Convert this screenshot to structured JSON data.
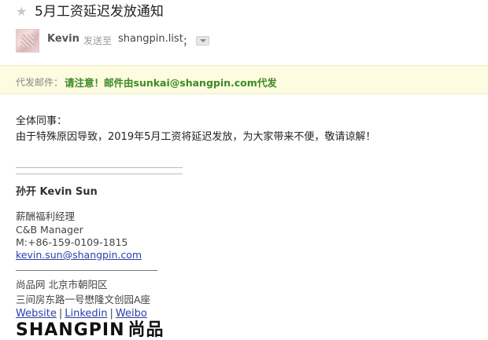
{
  "email": {
    "subject": "5月工资延迟发放通知",
    "sender_name": "Kevin",
    "to_label": "发送至",
    "recipient": "shangpin.list",
    "separator": "；"
  },
  "proxy": {
    "label": "代发邮件：",
    "notice": "请注意！邮件由sunkai@shangpin.com代发"
  },
  "body": {
    "greeting": "全体同事：",
    "message": "由于特殊原因导致，2019年5月工资将延迟发放，为大家带来不便，敬请谅解！"
  },
  "signature": {
    "name": "孙开 Kevin Sun",
    "title_cn": "薪酬福利经理",
    "title_en": "C&B Manager",
    "phone": "M:+86-159-0109-1815",
    "email": "kevin.sun@shangpin.com",
    "company": "尚品网 北京市朝阳区",
    "address": "三间房东路一号懋隆文创园A座",
    "links": [
      "Website",
      "Linkedin",
      "Weibo"
    ],
    "link_separator": "|",
    "logo_en": "SHANGPIN",
    "logo_cn": "尚品"
  },
  "icons": {
    "star": "star-icon",
    "expand": "chevron-down-icon"
  },
  "colors": {
    "proxy_background": "#fdfbe0",
    "proxy_notice": "#3a8a24",
    "link": "#2b3fa8"
  }
}
